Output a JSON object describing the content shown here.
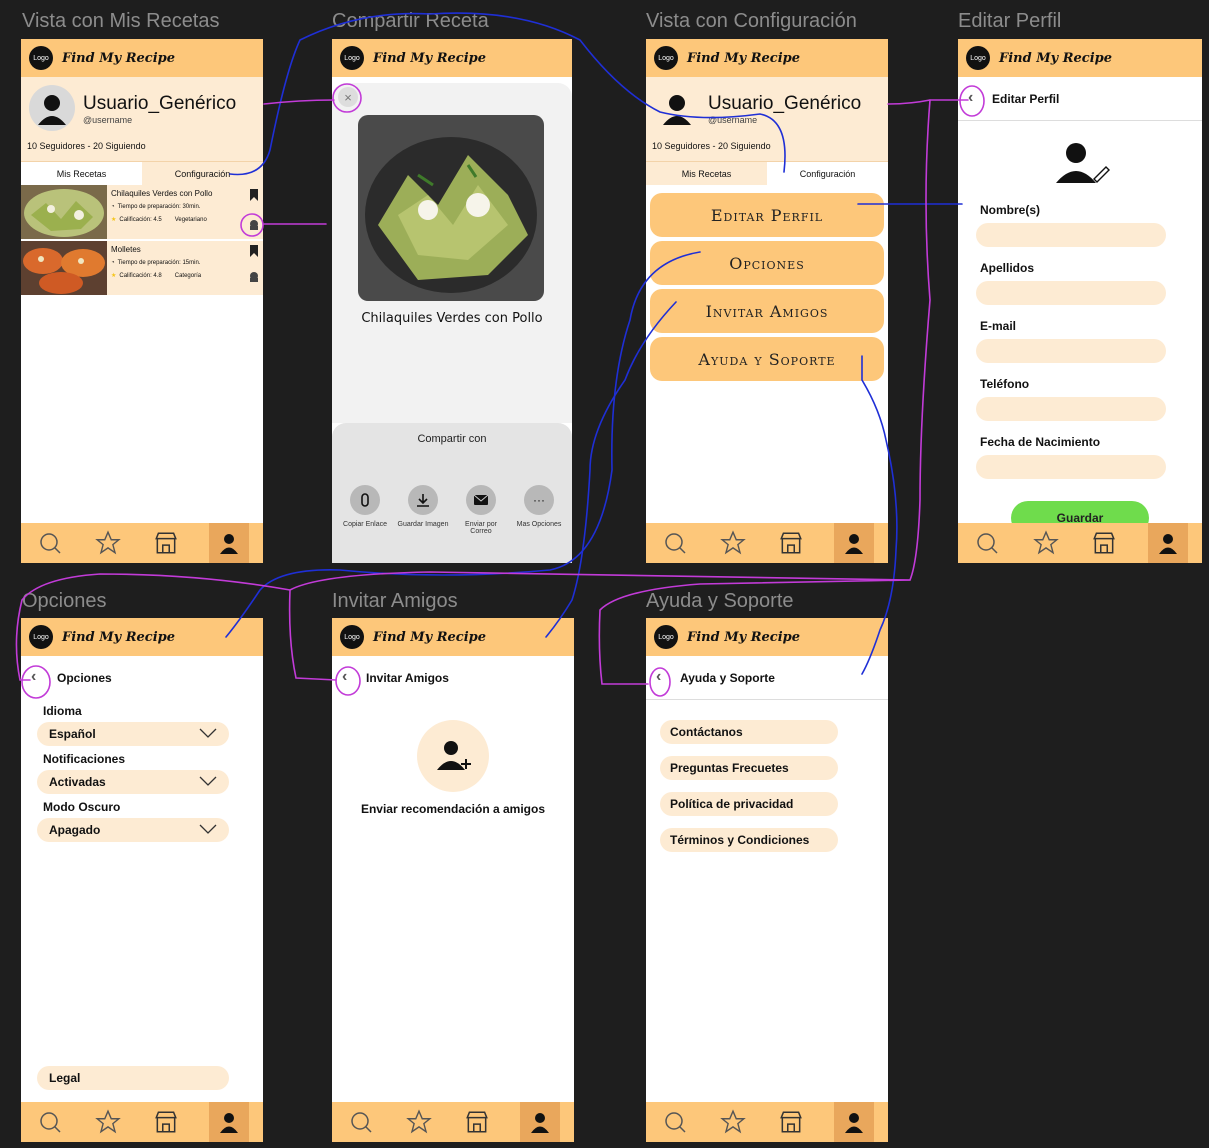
{
  "app": {
    "brand": "Find My Recipe",
    "logo_text": "Logo"
  },
  "frames": {
    "my_recipes": "Vista con Mis Recetas",
    "share": "Compartir Receta",
    "config": "Vista con Configuración",
    "edit_profile": "Editar Perfil",
    "options": "Opciones",
    "invite": "Invitar Amigos",
    "help": "Ayuda y Soporte"
  },
  "profile": {
    "name": "Usuario_Genérico",
    "handle": "@username",
    "followers": "10 Seguidores - 20 Siguiendo"
  },
  "tabs": {
    "recipes": "Mis Recetas",
    "config": "Configuración"
  },
  "recipes": [
    {
      "title": "Chilaquiles Verdes con Pollo",
      "prep": "Tiempo de preparación: 30min.",
      "rating": "Calificación: 4.5",
      "tag": "Vegetariano"
    },
    {
      "title": "Molletes",
      "prep": "Tiempo de preparación: 15min.",
      "rating": "Calificación: 4.8",
      "tag": "Categoría"
    }
  ],
  "share": {
    "recipe_title": "Chilaquiles Verdes con Pollo",
    "share_with": "Compartir con",
    "actions": [
      {
        "label": "Copiar Enlace",
        "icon": "paperclip-icon"
      },
      {
        "label": "Guardar Imagen",
        "icon": "download-icon"
      },
      {
        "label": "Enviar por Correo",
        "icon": "mail-icon"
      },
      {
        "label": "Mas Opciones",
        "icon": "more-icon"
      }
    ]
  },
  "config_buttons": [
    "Editar Perfil",
    "Opciones",
    "Invitar Amigos",
    "Ayuda y Soporte"
  ],
  "edit_profile": {
    "title": "Editar Perfil",
    "fields": [
      "Nombre(s)",
      "Apellidos",
      "E-mail",
      "Teléfono",
      "Fecha de Nacimiento"
    ],
    "save": "Guardar"
  },
  "options": {
    "title": "Opciones",
    "language_label": "Idioma",
    "language_value": "Español",
    "notifications_label": "Notificaciones",
    "notifications_value": "Activadas",
    "dark_label": "Modo Oscuro",
    "dark_value": "Apagado",
    "legal": "Legal"
  },
  "invite": {
    "title": "Invitar Amigos",
    "cta": "Enviar recomendación a amigos"
  },
  "help": {
    "title": "Ayuda y Soporte",
    "items": [
      "Contáctanos",
      "Preguntas Frecuetes",
      "Política de privacidad",
      "Términos y Condiciones"
    ]
  },
  "colors": {
    "primary": "#fdc77a",
    "light": "#fdebd3",
    "accent_green": "#6fdc4c",
    "annotation_blue": "#1f2fd6",
    "annotation_purple": "#c23bd8",
    "background": "#1e1e1e"
  }
}
